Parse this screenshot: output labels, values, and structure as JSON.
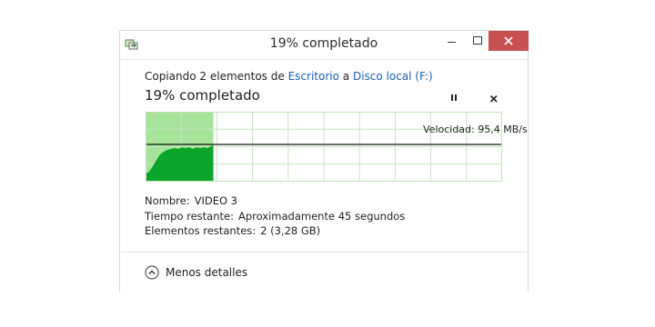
{
  "window": {
    "title": "19% completado",
    "controls": {
      "minimize": "minimize",
      "maximize": "maximize",
      "close": "close"
    }
  },
  "copy": {
    "prefix": "Copiando 2 elementos de",
    "source": "Escritorio",
    "connector": "a",
    "destination": "Disco local (F:)",
    "progress_title": "19% completado",
    "progress_fraction": 0.19,
    "speed_label": "Velocidad: 95,4 MB/s"
  },
  "details": {
    "name_label": "Nombre:",
    "name_value": "VIDEO 3",
    "time_label": "Tiempo restante:",
    "time_value": "Aproximadamente 45 segundos",
    "items_label": "Elementos restantes:",
    "items_value": "2 (3,28 GB)"
  },
  "footer": {
    "toggle_label": "Menos detalles"
  },
  "colors": {
    "progress_fill": "#a6e39b",
    "speed_area": "#0aa52a",
    "grid_line": "#c3e8bd",
    "close_button": "#c75050",
    "link": "#1a5fb4"
  },
  "icons": {
    "app": "copy-transfer-icon",
    "pause": "pause-icon",
    "cancel": "close-icon",
    "toggle": "chevron-up-circle-icon"
  }
}
